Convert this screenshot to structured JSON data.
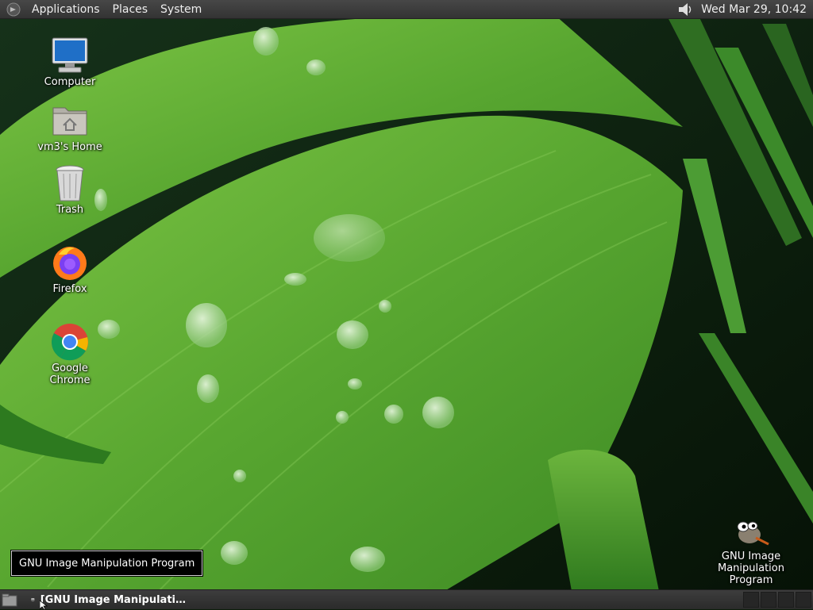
{
  "top_panel": {
    "menus": [
      "Applications",
      "Places",
      "System"
    ],
    "clock": "Wed Mar 29, 10:42",
    "tray_icons": [
      "volume-icon"
    ]
  },
  "desktop": {
    "icons": [
      {
        "label": "Computer",
        "icon": "computer-icon"
      },
      {
        "label": "vm3's Home",
        "icon": "home-folder-icon"
      },
      {
        "label": "Trash",
        "icon": "trash-icon"
      },
      {
        "label": "Firefox",
        "icon": "firefox-icon"
      },
      {
        "label": "Google Chrome",
        "icon": "chrome-icon"
      }
    ],
    "gimp_icon": {
      "label_line1": "GNU Image",
      "label_line2": "Manipulation Program",
      "icon": "gimp-icon"
    }
  },
  "tooltip": {
    "text": "GNU Image Manipulation Program"
  },
  "bottom_panel": {
    "task": {
      "label": "[GNU Image Manipulati…",
      "icon": "gimp-icon"
    },
    "workspaces": 4
  },
  "colors": {
    "panel": "#3a3a3a",
    "leaf_green": "#5aa832",
    "dark_green": "#0c1e0b"
  }
}
